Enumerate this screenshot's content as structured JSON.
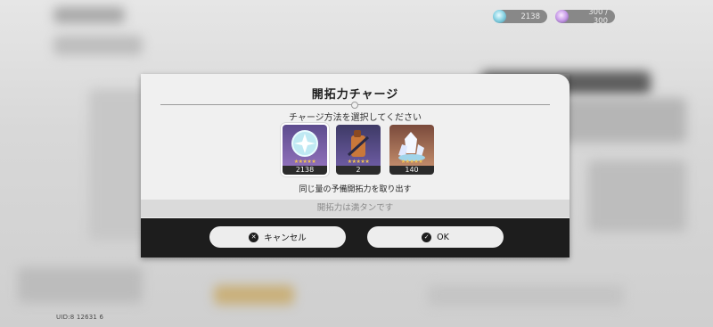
{
  "topbar": {
    "currency1": {
      "icon": "stellar-jade-icon",
      "value": "2138"
    },
    "currency2": {
      "icon": "trailblaze-power-icon",
      "value": "300 / 300"
    }
  },
  "uid": "UID:8 12631 6",
  "dialog": {
    "title": "開拓力チャージ",
    "subtitle": "チャージ方法を選択してください",
    "items": [
      {
        "icon": "stellar-jade-icon",
        "stars": "★★★★★",
        "count": "2138",
        "selected": true
      },
      {
        "icon": "fuel-icon",
        "stars": "★★★★★",
        "count": "2",
        "selected": false
      },
      {
        "icon": "reserved-power-crystal-icon",
        "stars": "★★★★★",
        "count": "140",
        "selected": false
      }
    ],
    "description": "同じ量の予備開拓力を取り出す",
    "status": "開拓力は満タンです",
    "cancel_label": "キャンセル",
    "ok_label": "OK"
  }
}
